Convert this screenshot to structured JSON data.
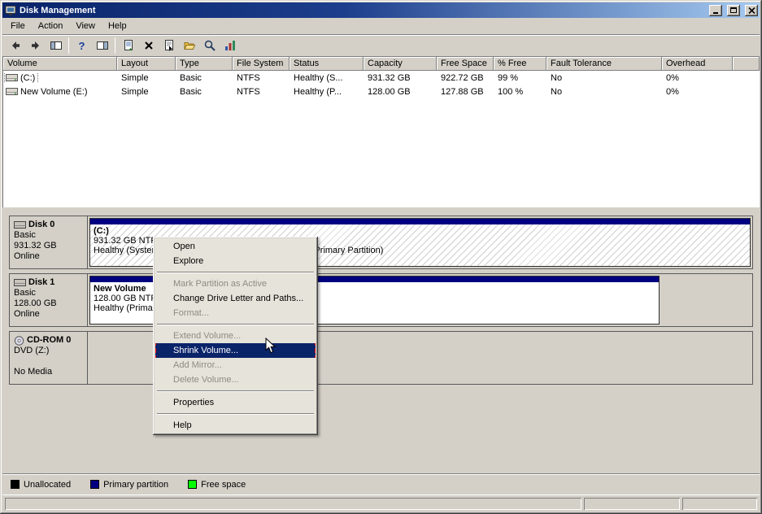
{
  "window": {
    "title": "Disk Management"
  },
  "menu_bar": {
    "items": [
      "File",
      "Action",
      "View",
      "Help"
    ]
  },
  "toolbar": {
    "buttons": [
      "back",
      "forward",
      "show-console-tree",
      "help",
      "show-action-pane",
      "export-list",
      "delete",
      "properties",
      "open-folder",
      "find",
      "views"
    ]
  },
  "volume_table": {
    "columns": [
      "Volume",
      "Layout",
      "Type",
      "File System",
      "Status",
      "Capacity",
      "Free Space",
      "% Free",
      "Fault Tolerance",
      "Overhead"
    ],
    "rows": [
      {
        "volume": "(C:)",
        "layout": "Simple",
        "type": "Basic",
        "file_system": "NTFS",
        "status": "Healthy (S...",
        "capacity": "931.32 GB",
        "free_space": "922.72 GB",
        "pct_free": "99 %",
        "fault_tolerance": "No",
        "overhead": "0%"
      },
      {
        "volume": "New Volume (E:)",
        "layout": "Simple",
        "type": "Basic",
        "file_system": "NTFS",
        "status": "Healthy (P...",
        "capacity": "128.00 GB",
        "free_space": "127.88 GB",
        "pct_free": "100 %",
        "fault_tolerance": "No",
        "overhead": "0%"
      }
    ]
  },
  "graphical_view": {
    "disks": [
      {
        "name": "Disk 0",
        "kind": "Basic",
        "size": "931.32 GB",
        "state": "Online",
        "partition": {
          "label": "(C:)",
          "detail": "931.32 GB NTFS",
          "status": "Healthy (System, Boot, Page File, Active, Crash Dump, Primary Partition)"
        }
      },
      {
        "name": "Disk 1",
        "kind": "Basic",
        "size": "128.00 GB",
        "state": "Online",
        "partition": {
          "label": "New Volume",
          "detail": "128.00 GB NTFS",
          "status": "Healthy (Primary Partition)"
        }
      },
      {
        "name": "CD-ROM 0",
        "kind": "DVD (Z:)",
        "size": "",
        "state": "No Media"
      }
    ]
  },
  "context_menu": {
    "items": [
      {
        "label": "Open",
        "state": "enabled"
      },
      {
        "label": "Explore",
        "state": "enabled"
      },
      {
        "type": "separator"
      },
      {
        "label": "Mark Partition as Active",
        "state": "disabled"
      },
      {
        "label": "Change Drive Letter and Paths...",
        "state": "enabled"
      },
      {
        "label": "Format...",
        "state": "disabled"
      },
      {
        "type": "separator"
      },
      {
        "label": "Extend Volume...",
        "state": "disabled"
      },
      {
        "label": "Shrink Volume...",
        "state": "highlighted"
      },
      {
        "label": "Add Mirror...",
        "state": "disabled"
      },
      {
        "label": "Delete Volume...",
        "state": "disabled"
      },
      {
        "type": "separator"
      },
      {
        "label": "Properties",
        "state": "enabled"
      },
      {
        "type": "separator"
      },
      {
        "label": "Help",
        "state": "enabled"
      }
    ],
    "annotation_color": "#ff0000"
  },
  "legend": {
    "items": [
      {
        "label": "Unallocated",
        "color": "#000000"
      },
      {
        "label": "Primary partition",
        "color": "#000080"
      },
      {
        "label": "Free space",
        "color": "#00ff00"
      }
    ]
  },
  "colors": {
    "title_gradient_start": "#0a246a",
    "title_gradient_end": "#a6caf0",
    "chrome": "#d4d0c8",
    "menu_highlight": "#0a246a",
    "partition_stripe": "#000080"
  }
}
